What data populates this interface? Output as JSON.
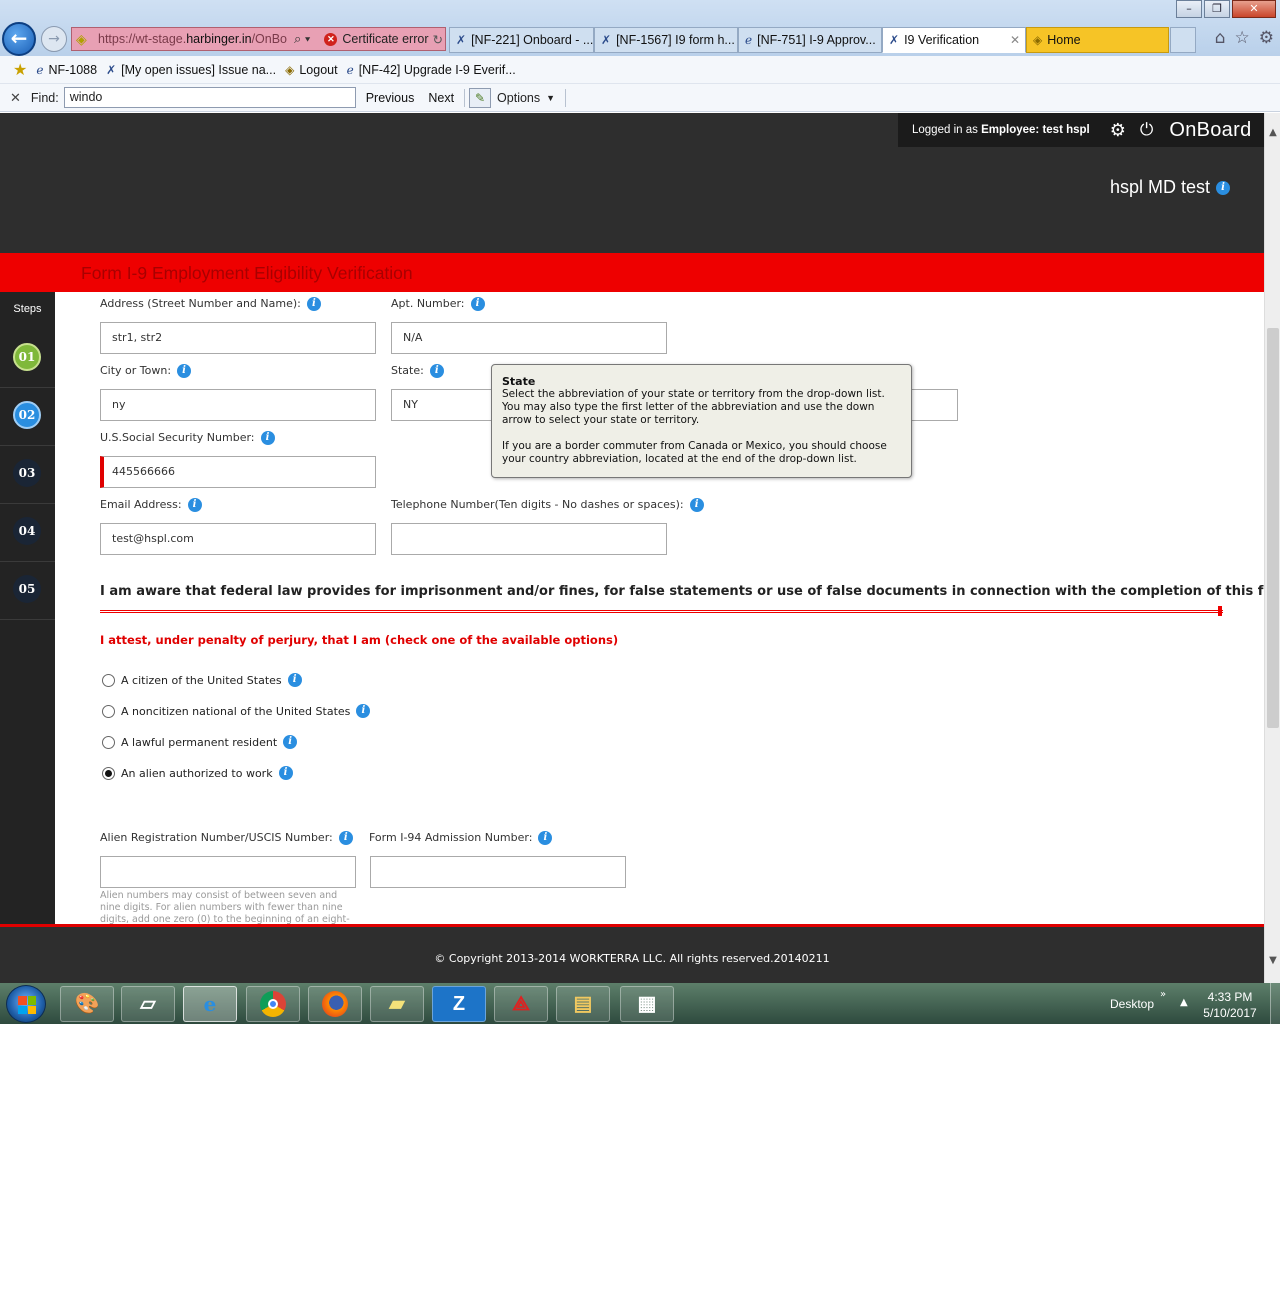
{
  "browser": {
    "url_prefix": "https://wt-stage.",
    "url_domain": "harbinger.in",
    "url_suffix": "/OnBo",
    "cert_error": "Certificate error",
    "tabs": [
      {
        "label": "[NF-221] Onboard - ...",
        "icon": "jira-icon"
      },
      {
        "label": "[NF-1567] I9 form h...",
        "icon": "jira-icon"
      },
      {
        "label": "[NF-751] I-9 Approv...",
        "icon": "ie-page-icon"
      },
      {
        "label": "I9 Verification",
        "icon": "jira-icon",
        "active": true
      },
      {
        "label": "Home",
        "icon": "page-icon"
      }
    ],
    "favorites": [
      {
        "label": "NF-1088",
        "icon": "ie-page-icon"
      },
      {
        "label": "[My open issues] Issue na...",
        "icon": "jira-icon"
      },
      {
        "label": "Logout",
        "icon": "page-icon"
      },
      {
        "label": "[NF-42] Upgrade I-9 Everif...",
        "icon": "ie-page-icon"
      }
    ],
    "find": {
      "label": "Find:",
      "value": "windo",
      "previous": "Previous",
      "next": "Next",
      "options": "Options"
    }
  },
  "header": {
    "logged_in_prefix": "Logged in as",
    "logged_in_role": "Employee:",
    "user": "test hspl",
    "brand": "OnBoard",
    "company": "hspl MD test"
  },
  "form": {
    "title": "Form I-9 Employment Eligibility Verification",
    "steps_label": "Steps",
    "steps": [
      "01",
      "02",
      "03",
      "04",
      "05"
    ],
    "address_label": "Address (Street Number and Name):",
    "address_value": "str1, str2",
    "apt_label": "Apt. Number:",
    "apt_value": "N/A",
    "city_label": "City or Town:",
    "city_value": "ny",
    "state_label": "State:",
    "state_value": "NY",
    "ssn_label": "U.S.Social Security Number:",
    "ssn_value": "445566666",
    "email_label": "Email Address:",
    "email_value": "test@hspl.com",
    "phone_label": "Telephone Number(Ten digits - No dashes or spaces):",
    "phone_value": "",
    "tooltip": {
      "title": "State",
      "p1": "Select the abbreviation of your state or territory from the drop-down list. You may also type the first letter of the abbreviation and use the down arrow to select your state or territory.",
      "p2": "If you are a border commuter from Canada or Mexico, you should choose your country abbreviation, located at the end of the drop-down list."
    },
    "warning": "I am aware that federal law provides for imprisonment and/or fines, for false statements or use of false documents in connection with the completion of this form",
    "attest": "I attest, under penalty of perjury, that I am (check one of the available options)",
    "options": [
      {
        "label": "A citizen of the United States",
        "checked": false
      },
      {
        "label": "A noncitizen national of the United States",
        "checked": false
      },
      {
        "label": "A lawful permanent resident",
        "checked": false
      },
      {
        "label": "An alien authorized to work",
        "checked": true
      }
    ],
    "alien_label": "Alien Registration Number/USCIS Number:",
    "alien_value": "",
    "i94_label": "Form I-94 Admission Number:",
    "i94_value": "",
    "alien_hint": "Alien numbers may consist of between seven and nine digits. For alien numbers with fewer than nine digits, add one zero (0) to the beginning of an eight-digit alien"
  },
  "footer": {
    "copyright": "© Copyright 2013-2014 WORKTERRA LLC. All rights reserved.20140211"
  },
  "taskbar": {
    "desktop_label": "Desktop",
    "time": "4:33 PM",
    "date": "5/10/2017"
  }
}
